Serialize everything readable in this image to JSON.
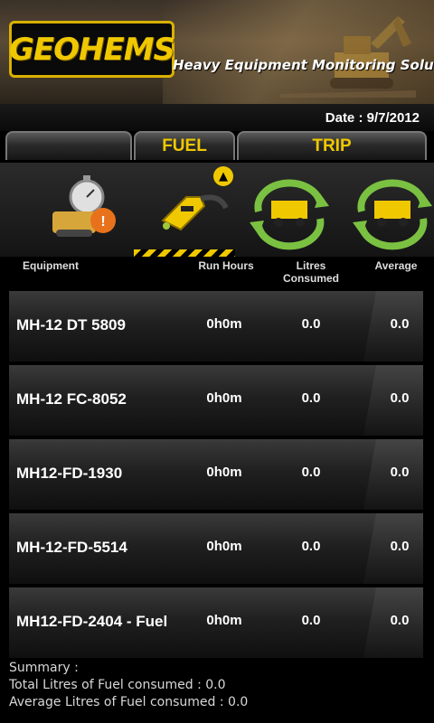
{
  "header": {
    "logo_text": "GEOHEMS",
    "tagline": "Heavy Equipment Monitoring Solution"
  },
  "date": {
    "text": "Date : 9/7/2012"
  },
  "tabs": [
    {
      "label": ""
    },
    {
      "label": "FUEL"
    },
    {
      "label": "TRIP"
    }
  ],
  "icons": [
    {
      "name": "alert-stopwatch-icon"
    },
    {
      "name": "fuel-nozzle-icon"
    },
    {
      "name": "trip-truck-icon"
    },
    {
      "name": "trip-truck-report-icon"
    }
  ],
  "columns": {
    "equipment": "Equipment",
    "run_hours": "Run Hours",
    "litres_line1": "Litres",
    "litres_line2": "Consumed",
    "average": "Average"
  },
  "rows": [
    {
      "equipment": "MH-12 DT 5809",
      "run_hours": "0h0m",
      "litres": "0.0",
      "average": "0.0"
    },
    {
      "equipment": "MH-12 FC-8052",
      "run_hours": "0h0m",
      "litres": "0.0",
      "average": "0.0"
    },
    {
      "equipment": "MH12-FD-1930",
      "run_hours": "0h0m",
      "litres": "0.0",
      "average": "0.0"
    },
    {
      "equipment": "MH-12-FD-5514",
      "run_hours": "0h0m",
      "litres": "0.0",
      "average": "0.0"
    },
    {
      "equipment": "MH12-FD-2404 - Fuel",
      "run_hours": "0h0m",
      "litres": "0.0",
      "average": "0.0"
    }
  ],
  "summary": {
    "title": "Summary :",
    "total": "Total Litres of Fuel consumed : 0.0",
    "average": "Average Litres of Fuel consumed : 0.0"
  },
  "colors": {
    "accent": "#f0c800",
    "background": "#000000"
  }
}
